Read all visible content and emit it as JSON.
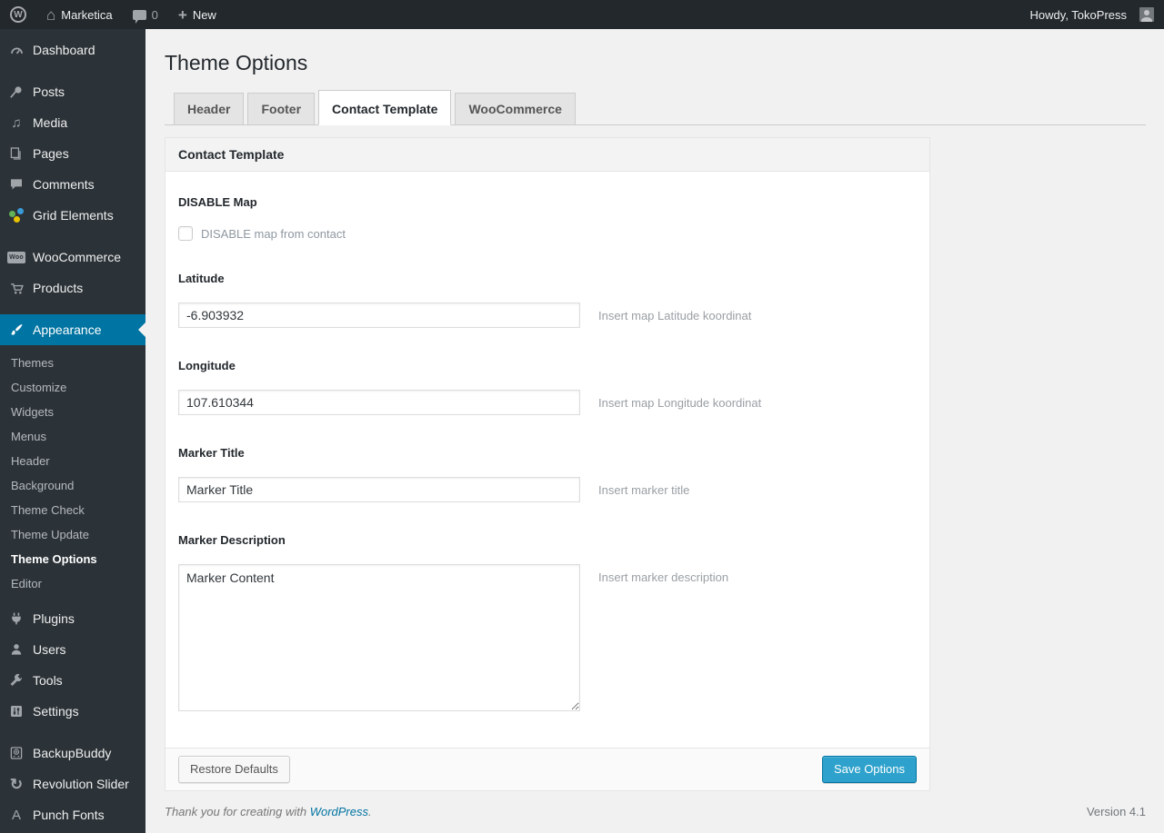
{
  "colors": {
    "admin_bar_bg": "#23282d",
    "sidebar_bg": "#2c3338",
    "accent_blue": "#0074a2",
    "primary_button_bg": "#2ea2cc",
    "body_bg": "#f1f1f1"
  },
  "admin_bar": {
    "wp_logo_letter": "W",
    "site_name": "Marketica",
    "comment_count": "0",
    "new_label": "New",
    "howdy": "Howdy, TokoPress"
  },
  "sidebar": {
    "items": [
      {
        "label": "Dashboard",
        "icon": "gauge-icon"
      },
      {
        "label": "Posts",
        "icon": "pushpin-icon"
      },
      {
        "label": "Media",
        "icon": "music-note-icon",
        "glyph": "♫"
      },
      {
        "label": "Pages",
        "icon": "stacked-pages-icon"
      },
      {
        "label": "Comments",
        "icon": "speech-bubble-icon"
      },
      {
        "label": "Grid Elements",
        "icon": "pinwheel-icon"
      },
      {
        "label": "WooCommerce",
        "icon": "woo-badge-icon",
        "badge": "Woo"
      },
      {
        "label": "Products",
        "icon": "cart-icon"
      },
      {
        "label": "Appearance",
        "icon": "paintbrush-icon",
        "current": true
      },
      {
        "label": "Plugins",
        "icon": "plug-icon"
      },
      {
        "label": "Users",
        "icon": "person-icon"
      },
      {
        "label": "Tools",
        "icon": "wrench-icon"
      },
      {
        "label": "Settings",
        "icon": "sliders-icon"
      },
      {
        "label": "BackupBuddy",
        "icon": "backup-drive-icon"
      },
      {
        "label": "Revolution Slider",
        "icon": "refresh-arrows-icon",
        "glyph": "↻"
      },
      {
        "label": "Punch Fonts",
        "icon": "letter-a-icon",
        "glyph": "A"
      }
    ],
    "appearance_submenu": [
      {
        "label": "Themes"
      },
      {
        "label": "Customize"
      },
      {
        "label": "Widgets"
      },
      {
        "label": "Menus"
      },
      {
        "label": "Header"
      },
      {
        "label": "Background"
      },
      {
        "label": "Theme Check"
      },
      {
        "label": "Theme Update"
      },
      {
        "label": "Theme Options",
        "current": true
      },
      {
        "label": "Editor"
      }
    ]
  },
  "main": {
    "title": "Theme Options",
    "tabs": [
      {
        "label": "Header",
        "active": false
      },
      {
        "label": "Footer",
        "active": false
      },
      {
        "label": "Contact Template",
        "active": true
      },
      {
        "label": "WooCommerce",
        "active": false
      }
    ],
    "panel": {
      "title": "Contact Template",
      "disable_map": {
        "label": "DISABLE Map",
        "checkbox_label": "DISABLE map from contact",
        "checked": false
      },
      "fields": {
        "latitude": {
          "label": "Latitude",
          "value": "-6.903932",
          "hint": "Insert map Latitude koordinat"
        },
        "longitude": {
          "label": "Longitude",
          "value": "107.610344",
          "hint": "Insert map Longitude koordinat"
        },
        "marker_title": {
          "label": "Marker Title",
          "value": "Marker Title",
          "hint": "Insert marker title"
        },
        "marker_description": {
          "label": "Marker Description",
          "value": "Marker Content",
          "hint": "Insert marker description"
        }
      },
      "buttons": {
        "restore": "Restore Defaults",
        "save": "Save Options"
      }
    }
  },
  "footer": {
    "thanks_prefix": "Thank you for creating with ",
    "wordpress_link": "WordPress",
    "thanks_suffix": ".",
    "version": "Version 4.1"
  }
}
